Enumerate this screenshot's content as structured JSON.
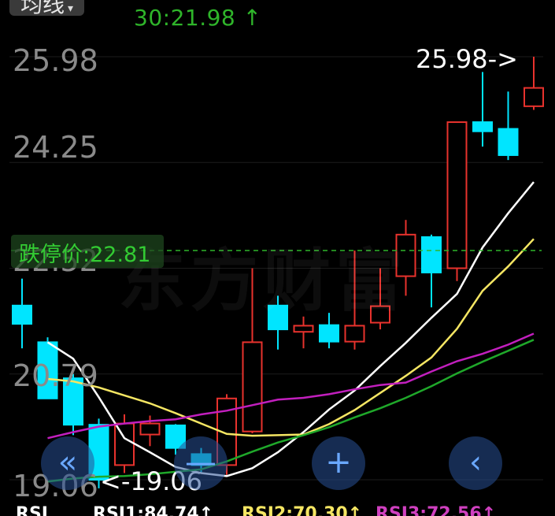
{
  "header": {
    "chip_label": "均线",
    "timestamp": "30:21.98 ↑"
  },
  "y_axis_labels": [
    "25.98",
    "24.25",
    "22.52",
    "20.79",
    "19.06"
  ],
  "limit": {
    "label": "跌停价:22.81",
    "value": 22.81
  },
  "markers": {
    "high_label": "25.98->",
    "low_label": "<-19.06"
  },
  "watermark": "东方财富",
  "controls": [
    "«",
    "—",
    "+",
    "‹"
  ],
  "bottom_bar": {
    "tab": "RSI",
    "rsi1": "RSI1:84.74↑",
    "rsi2": "RSI2:70.30↑",
    "rsi3": "RSI3:72.56↑"
  },
  "colors": {
    "up": "#e8322d",
    "down": "#00e5ff",
    "ma5": "#ffffff",
    "ma10": "#f5e663",
    "ma20": "#c21fbe",
    "ma30": "#1fa82a",
    "limit_line": "#2fb52a"
  },
  "chart_data": {
    "type": "candlestick",
    "y_range": [
      19.06,
      25.98
    ],
    "candles": [
      {
        "o": 21.91,
        "c": 21.61,
        "h": 22.35,
        "l": 21.21
      },
      {
        "o": 21.31,
        "c": 20.39,
        "h": 21.39,
        "l": 20.39
      },
      {
        "o": 20.72,
        "c": 19.96,
        "h": 20.79,
        "l": 19.79
      },
      {
        "o": 19.96,
        "c": 19.06,
        "h": 20.06,
        "l": 18.92
      },
      {
        "o": 19.3,
        "c": 19.98,
        "h": 20.13,
        "l": 19.17
      },
      {
        "o": 19.8,
        "c": 19.98,
        "h": 20.11,
        "l": 19.61
      },
      {
        "o": 19.95,
        "c": 19.58,
        "h": 19.97,
        "l": 19.47
      },
      {
        "o": 19.48,
        "c": 19.3,
        "h": 19.58,
        "l": 19.17
      },
      {
        "o": 19.3,
        "c": 20.39,
        "h": 20.46,
        "l": 19.14
      },
      {
        "o": 19.85,
        "c": 21.31,
        "h": 22.52,
        "l": 19.82
      },
      {
        "o": 21.91,
        "c": 21.52,
        "h": 22.07,
        "l": 21.19
      },
      {
        "o": 21.48,
        "c": 21.58,
        "h": 21.73,
        "l": 21.21
      },
      {
        "o": 21.59,
        "c": 21.32,
        "h": 21.79,
        "l": 21.21
      },
      {
        "o": 21.32,
        "c": 21.58,
        "h": 22.81,
        "l": 21.19
      },
      {
        "o": 21.63,
        "c": 21.9,
        "h": 22.52,
        "l": 21.52
      },
      {
        "o": 22.39,
        "c": 23.07,
        "h": 23.31,
        "l": 22.07
      },
      {
        "o": 23.03,
        "c": 22.45,
        "h": 23.07,
        "l": 21.88
      },
      {
        "o": 22.52,
        "c": 24.91,
        "h": 24.91,
        "l": 22.31
      },
      {
        "o": 24.91,
        "c": 24.76,
        "h": 25.73,
        "l": 24.51
      },
      {
        "o": 24.8,
        "c": 24.37,
        "h": 25.41,
        "l": 24.29
      },
      {
        "o": 25.17,
        "c": 25.47,
        "h": 25.98,
        "l": 25.11
      }
    ],
    "ma": [
      {
        "name": "MA5",
        "color": "#ffffff",
        "values": [
          null,
          21.31,
          21.04,
          20.41,
          19.74,
          19.51,
          19.27,
          19.17,
          19.12,
          19.25,
          19.51,
          19.84,
          20.21,
          20.52,
          20.92,
          21.3,
          21.71,
          22.1,
          22.86,
          23.42,
          23.93
        ]
      },
      {
        "name": "MA10",
        "color": "#f5e663",
        "values": [
          null,
          20.71,
          20.67,
          20.57,
          20.44,
          20.31,
          20.15,
          19.98,
          19.81,
          19.78,
          19.79,
          19.8,
          19.97,
          20.2,
          20.48,
          20.76,
          21.06,
          21.53,
          22.15,
          22.55,
          23.0
        ]
      },
      {
        "name": "MA20",
        "color": "#c21fbe",
        "values": [
          null,
          19.74,
          19.84,
          19.93,
          19.98,
          20.02,
          20.05,
          20.13,
          20.19,
          20.28,
          20.37,
          20.4,
          20.46,
          20.54,
          20.61,
          20.65,
          20.83,
          21.0,
          21.12,
          21.27,
          21.45
        ]
      },
      {
        "name": "MA30",
        "color": "#1fa82a",
        "values": [
          null,
          19.03,
          19.08,
          19.11,
          19.12,
          19.15,
          19.19,
          19.23,
          19.36,
          19.52,
          19.67,
          19.79,
          19.92,
          20.08,
          20.23,
          20.4,
          20.59,
          20.8,
          20.99,
          21.17,
          21.35
        ]
      }
    ]
  }
}
